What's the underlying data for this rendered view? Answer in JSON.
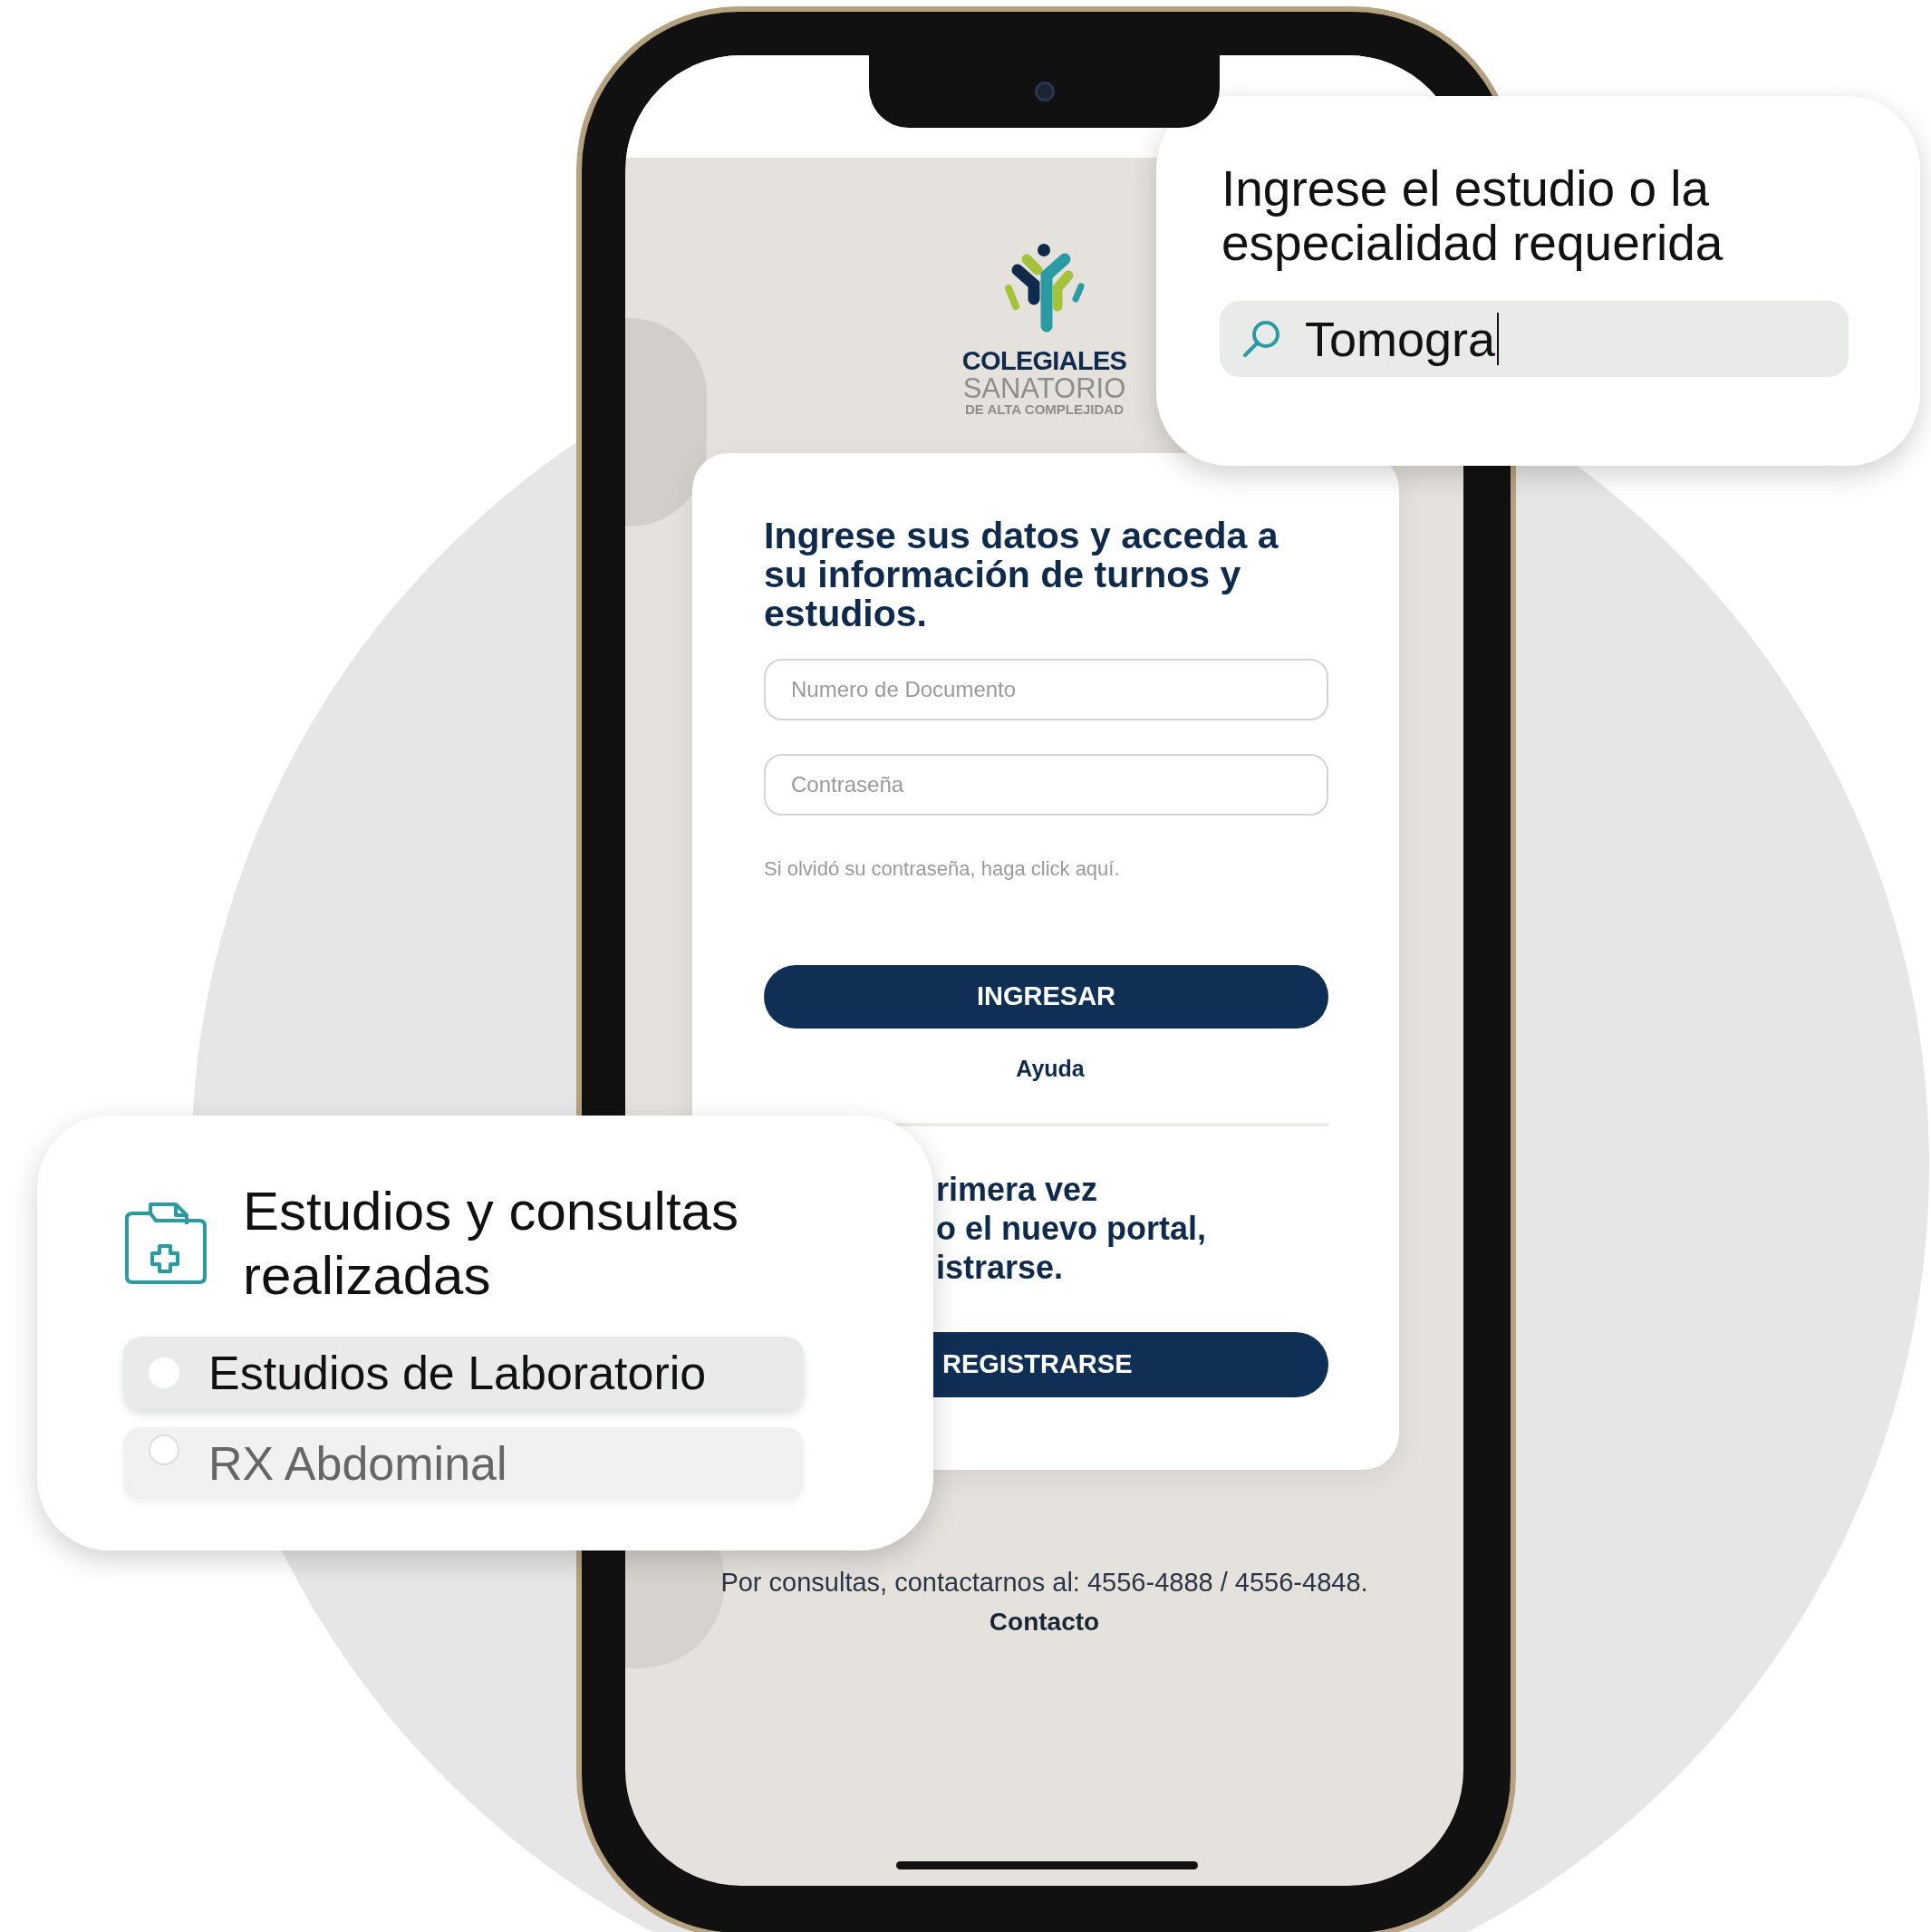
{
  "screen": {
    "logo": {
      "name": "COLEGIALES",
      "subtitle": "SANATORIO",
      "tagline": "DE ALTA COMPLEJIDAD"
    },
    "login_card": {
      "heading": "Ingrese sus datos y acceda a su información de turnos y estudios.",
      "fields": [
        {
          "placeholder": "Numero de Documento"
        },
        {
          "placeholder": "Contraseña"
        }
      ],
      "forgot_link": "Si olvidó su contraseña, haga click aquí.",
      "login_button": "INGRESAR",
      "help_link": "Ayuda",
      "register_text": [
        "rimera vez",
        "o el nuevo portal,",
        "istrarse."
      ],
      "register_button": "REGISTRARSE"
    },
    "footer": {
      "contact_text": "Por consultas, contactarnos al: 4556-4888 / 4556-4848.",
      "contact_link": "Contacto"
    }
  },
  "search_callout": {
    "title": "Ingrese el estudio o la especialidad requerida",
    "search": {
      "value": "Tomogra"
    }
  },
  "history_callout": {
    "title": "Estudios y consultas realizadas",
    "items": [
      {
        "label": "Estudios de Laboratorio",
        "selected": true
      },
      {
        "label": "RX Abdominal",
        "selected": false
      }
    ]
  }
}
